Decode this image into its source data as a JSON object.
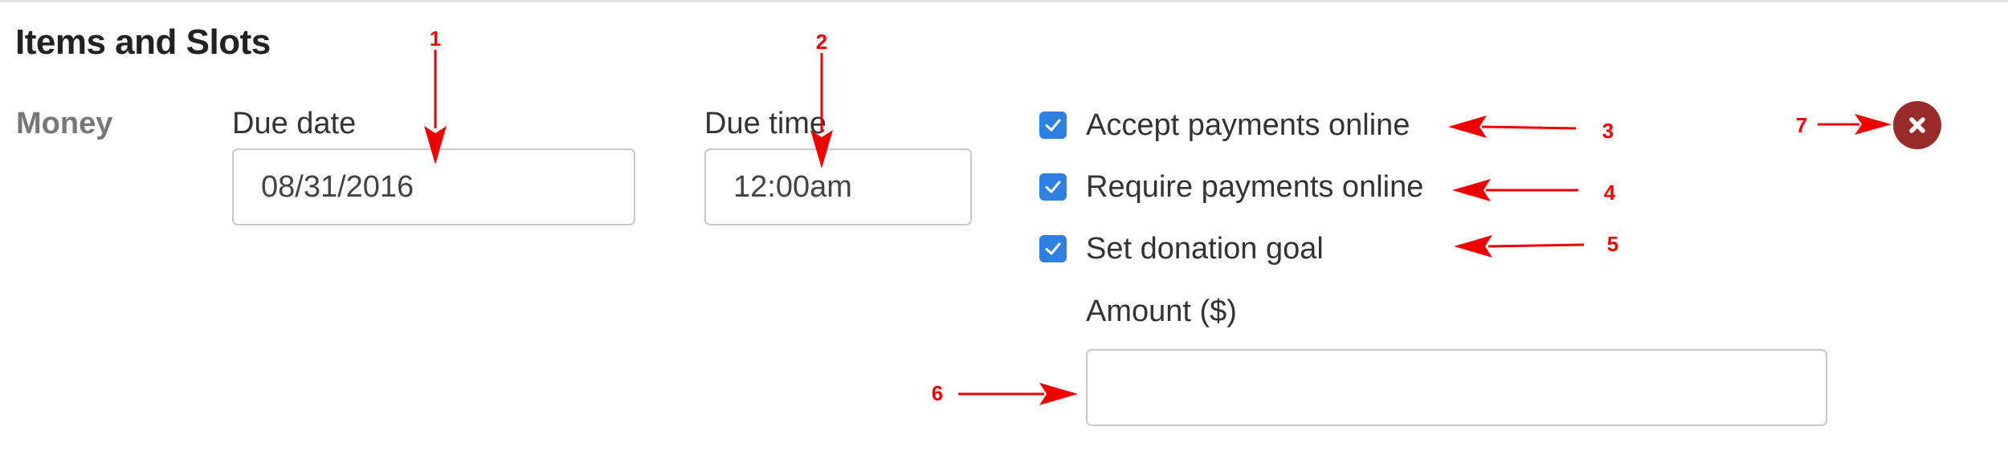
{
  "section": {
    "title": "Items and Slots"
  },
  "money_row": {
    "label": "Money",
    "due_date": {
      "label": "Due date",
      "value": "08/31/2016"
    },
    "due_time": {
      "label": "Due time",
      "value": "12:00am"
    },
    "options": [
      {
        "label": "Accept payments online",
        "checked": true
      },
      {
        "label": "Require payments online",
        "checked": true
      },
      {
        "label": "Set donation goal",
        "checked": true
      }
    ],
    "amount": {
      "label": "Amount ($)",
      "value": ""
    }
  },
  "annotations": [
    "1",
    "2",
    "3",
    "4",
    "5",
    "6",
    "7"
  ],
  "colors": {
    "checkbox": "#2d7fe0",
    "remove_button": "#9a2b2b",
    "annotation": "#ee0000",
    "input_border": "#c9c9c9",
    "muted_label": "#777777"
  },
  "icons": {
    "checkbox": "checkmark-icon",
    "remove": "close-icon",
    "annotation": "arrow-icon"
  }
}
